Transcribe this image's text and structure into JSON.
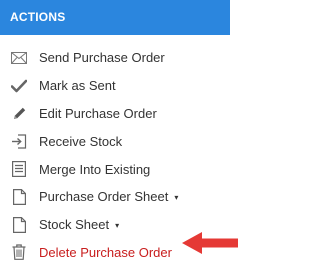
{
  "panel": {
    "title": "ACTIONS",
    "accent_color": "#2b86de",
    "danger_color": "#c81e1e"
  },
  "menu": {
    "items": [
      {
        "label": "Send Purchase Order",
        "icon": "envelope-icon"
      },
      {
        "label": "Mark as Sent",
        "icon": "checkmark-icon"
      },
      {
        "label": "Edit Purchase Order",
        "icon": "pencil-icon"
      },
      {
        "label": "Receive Stock",
        "icon": "sign-in-icon"
      },
      {
        "label": "Merge Into Existing",
        "icon": "list-document-icon"
      },
      {
        "label": "Purchase Order Sheet",
        "icon": "document-icon",
        "caret": "▾"
      },
      {
        "label": "Stock Sheet",
        "icon": "document-icon",
        "caret": "▾"
      },
      {
        "label": "Delete Purchase Order",
        "icon": "trash-icon"
      }
    ]
  },
  "annotation": {
    "icon": "red-arrow-icon"
  }
}
